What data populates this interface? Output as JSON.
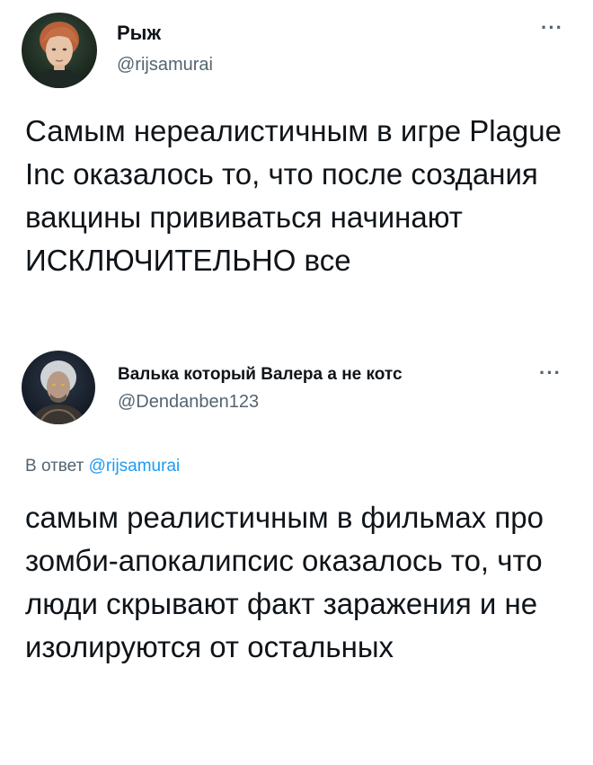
{
  "tweets": [
    {
      "author_name": "Рыж",
      "author_handle": "@rijsamurai",
      "more_label": "···",
      "text": "Самым нереалистичным в игре Plague Inc оказалось то, что после создания вакцины прививаться начинают ИСКЛЮЧИТЕЛЬНО все"
    },
    {
      "author_name": "Валька который Валера а не котс",
      "author_handle": "@Dendanben123",
      "more_label": "···",
      "reply_prefix": "В ответ",
      "reply_to": "@rijsamurai",
      "text": "самым реалистичным в фильмах про зомби-апокалипсис оказалось то, что люди скрывают факт заражения и не изолируются от остальных"
    }
  ],
  "colors": {
    "text": "#0f1419",
    "secondary": "#536471",
    "link": "#1d9bf0"
  },
  "icons": {
    "more": "more-horizontal-icon"
  }
}
